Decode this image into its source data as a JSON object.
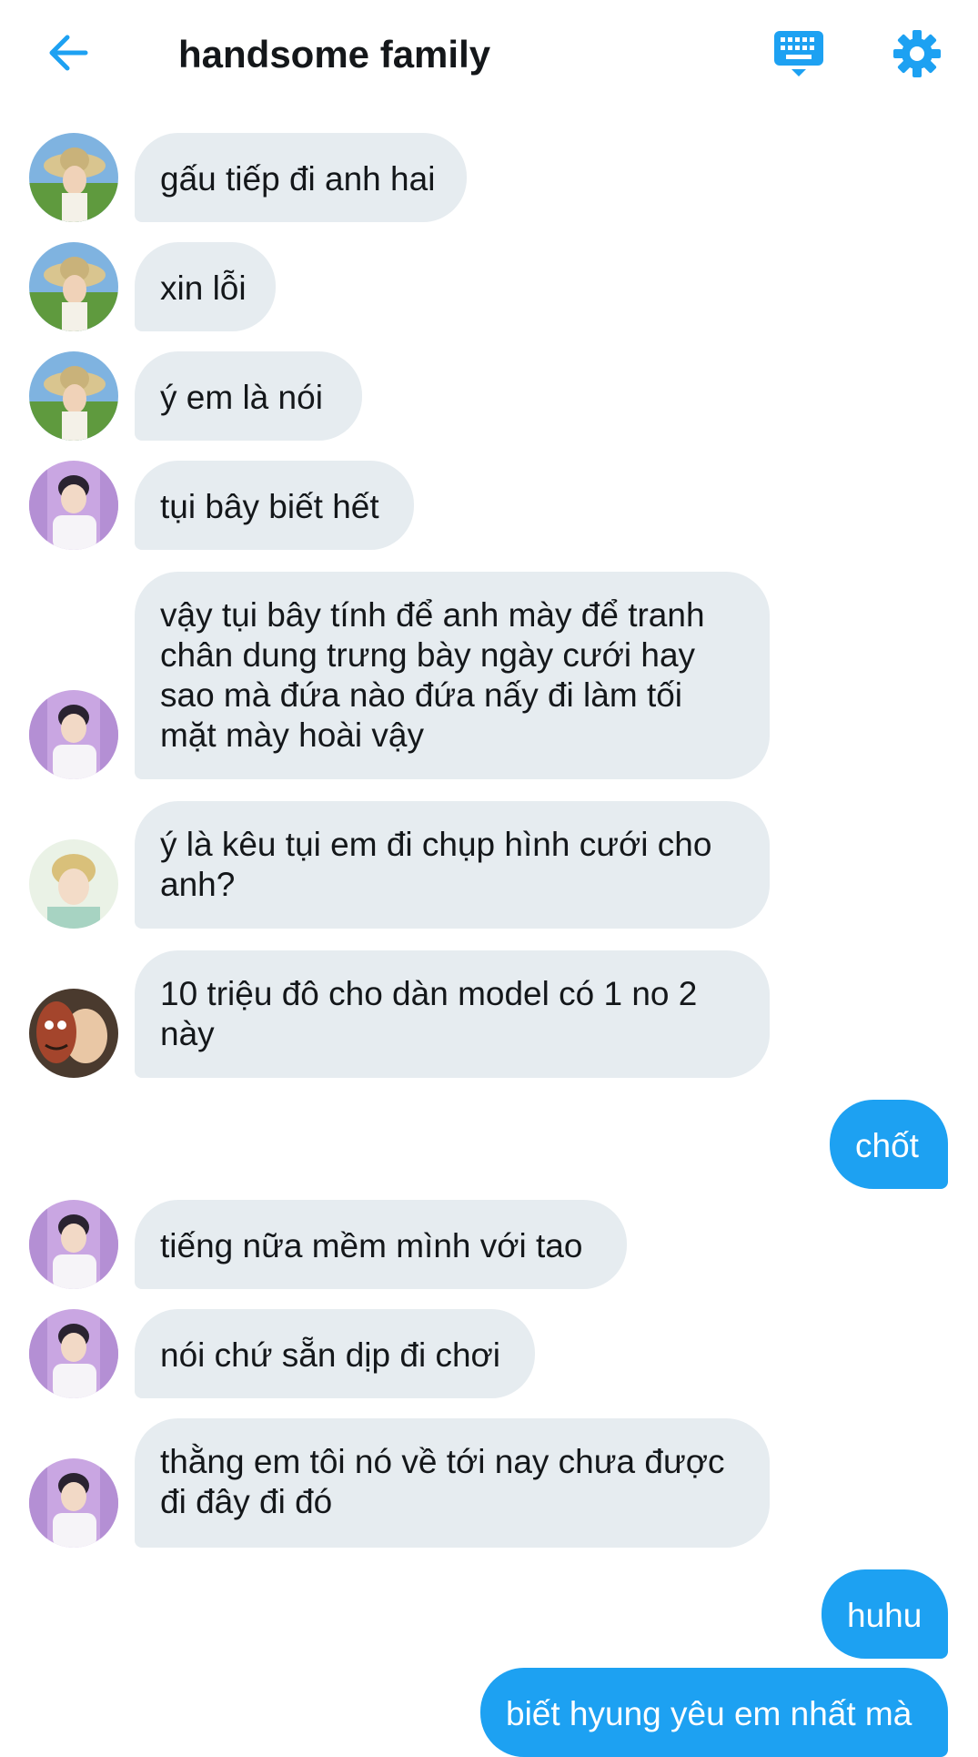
{
  "header": {
    "title": "handsome family",
    "back_icon": "arrow-left-icon",
    "keyboard_icon": "keyboard-icon",
    "settings_icon": "gear-icon",
    "accent_color": "#1da1f2"
  },
  "colors": {
    "incoming_bubble": "#e6ecf0",
    "outgoing_bubble": "#1da1f2",
    "text": "#14171a"
  },
  "messages": [
    {
      "direction": "incoming",
      "sender_avatar": "avatar-straw-hat",
      "text": "gấu tiếp đi anh hai"
    },
    {
      "direction": "incoming",
      "sender_avatar": "avatar-straw-hat",
      "text": "xin lỗi"
    },
    {
      "direction": "incoming",
      "sender_avatar": "avatar-straw-hat",
      "text": "ý em là nói"
    },
    {
      "direction": "incoming",
      "sender_avatar": "avatar-purple",
      "text": "tụi bây biết hết"
    },
    {
      "direction": "incoming",
      "sender_avatar": "avatar-purple",
      "text": "vậy tụi bây tính để anh mày để tranh chân dung trưng bày ngày cưới hay sao mà đứa nào đứa nấy đi làm tối mặt mày hoài vậy"
    },
    {
      "direction": "incoming",
      "sender_avatar": "avatar-blond",
      "text": "ý là kêu tụi em đi chụp hình cưới cho anh?"
    },
    {
      "direction": "incoming",
      "sender_avatar": "avatar-mask",
      "text": "10 triệu đô cho dàn model có 1 no 2 này"
    },
    {
      "direction": "outgoing",
      "text": "chốt"
    },
    {
      "direction": "incoming",
      "sender_avatar": "avatar-purple",
      "text": "tiếng nữa mềm mình với tao"
    },
    {
      "direction": "incoming",
      "sender_avatar": "avatar-purple",
      "text": "nói chứ sẵn dịp đi chơi"
    },
    {
      "direction": "incoming",
      "sender_avatar": "avatar-purple",
      "text": "thằng em tôi nó về tới nay chưa được đi đây đi đó"
    },
    {
      "direction": "outgoing",
      "text": "huhu"
    },
    {
      "direction": "outgoing",
      "text": "biết hyung yêu em nhất mà"
    }
  ]
}
